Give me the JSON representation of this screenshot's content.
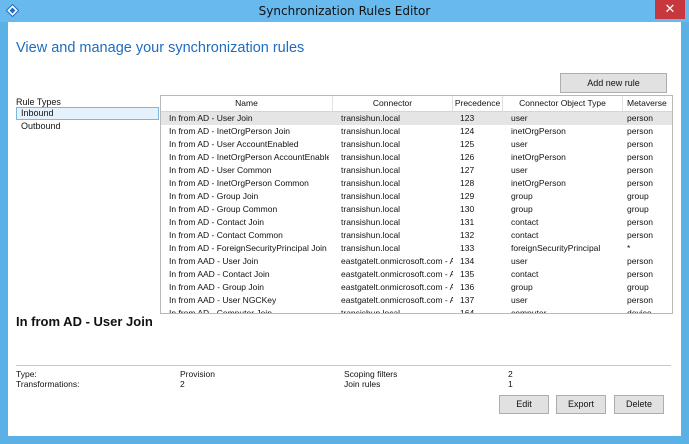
{
  "window": {
    "title": "Synchronization Rules Editor",
    "close_glyph": "✕"
  },
  "heading": "View and manage your synchronization rules",
  "add_rule_button": "Add new rule",
  "rule_types": {
    "label": "Rule Types",
    "items": [
      "Inbound",
      "Outbound"
    ],
    "selected": "Inbound"
  },
  "grid": {
    "columns": [
      "Name",
      "Connector",
      "Precedence",
      "Connector Object Type",
      "Metaverse"
    ],
    "rows": [
      [
        "In from AD - User Join",
        "transishun.local",
        "123",
        "user",
        "person"
      ],
      [
        "In from AD - InetOrgPerson Join",
        "transishun.local",
        "124",
        "inetOrgPerson",
        "person"
      ],
      [
        "In from AD - User AccountEnabled",
        "transishun.local",
        "125",
        "user",
        "person"
      ],
      [
        "In from AD - InetOrgPerson AccountEnabled",
        "transishun.local",
        "126",
        "inetOrgPerson",
        "person"
      ],
      [
        "In from AD - User Common",
        "transishun.local",
        "127",
        "user",
        "person"
      ],
      [
        "In from AD - InetOrgPerson Common",
        "transishun.local",
        "128",
        "inetOrgPerson",
        "person"
      ],
      [
        "In from AD - Group Join",
        "transishun.local",
        "129",
        "group",
        "group"
      ],
      [
        "In from AD - Group Common",
        "transishun.local",
        "130",
        "group",
        "group"
      ],
      [
        "In from AD - Contact Join",
        "transishun.local",
        "131",
        "contact",
        "person"
      ],
      [
        "In from AD - Contact Common",
        "transishun.local",
        "132",
        "contact",
        "person"
      ],
      [
        "In from AD - ForeignSecurityPrincipal Join User",
        "transishun.local",
        "133",
        "foreignSecurityPrincipal",
        "*"
      ],
      [
        "In from AAD - User Join",
        "eastgatelt.onmicrosoft.com - AAD",
        "134",
        "user",
        "person"
      ],
      [
        "In from AAD - Contact Join",
        "eastgatelt.onmicrosoft.com - AAD",
        "135",
        "contact",
        "person"
      ],
      [
        "In from AAD - Group Join",
        "eastgatelt.onmicrosoft.com - AAD",
        "136",
        "group",
        "group"
      ],
      [
        "In from AAD - User NGCKey",
        "eastgatelt.onmicrosoft.com - AAD",
        "137",
        "user",
        "person"
      ],
      [
        "In from AD - Computer Join",
        "transishun.local",
        "164",
        "computer",
        "device"
      ]
    ],
    "selected_row": 0
  },
  "detail": {
    "title": "In from AD - User Join",
    "type_label": "Type:",
    "type_value": "Provision",
    "transformations_label": "Transformations:",
    "transformations_value": "2",
    "scoping_label": "Scoping filters",
    "scoping_value": "2",
    "join_label": "Join rules",
    "join_value": "1"
  },
  "buttons": {
    "edit": "Edit",
    "export": "Export",
    "delete": "Delete"
  },
  "colors": {
    "titlebar": "#67b9ee",
    "accent": "#1f6dbf",
    "close": "#c7383e"
  }
}
